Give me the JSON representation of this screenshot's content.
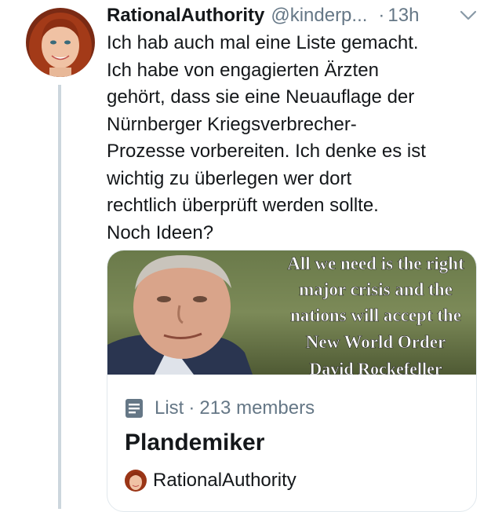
{
  "tweet": {
    "display_name": "RationalAuthority",
    "handle": "@kinderp...",
    "separator": "·",
    "time": "13h",
    "text_lines": [
      "Ich hab auch mal eine Liste gemacht.",
      "Ich habe von engagierten Ärzten",
      "gehört, dass sie eine Neuauflage der",
      "Nürnberger Kriegsverbrecher-",
      "Prozesse vorbereiten. Ich denke es ist",
      "wichtig zu überlegen wer dort",
      "rechtlich überprüft werden sollte.",
      "Noch Ideen?"
    ]
  },
  "card": {
    "image_quote_lines": [
      "All we need is the right",
      "major crisis and the",
      "nations will accept the",
      "New World Order"
    ],
    "image_attribution": "David Rockefeller",
    "type_label": "List",
    "separator": "·",
    "members": "213 members",
    "title": "Plandemiker",
    "owner": "RationalAuthority"
  },
  "icons": {
    "avatar": "avatar",
    "chevron": "chevron-down-icon",
    "list": "list-icon"
  },
  "colors": {
    "text": "#14171a",
    "secondary": "#657786",
    "border": "#e1e8ed",
    "thread_line": "#ccd6dd"
  }
}
